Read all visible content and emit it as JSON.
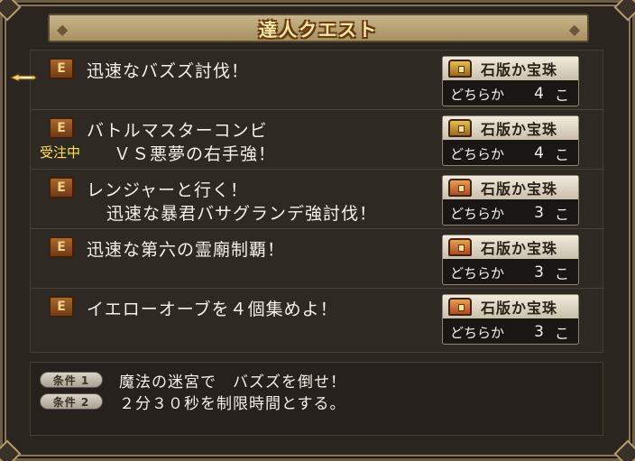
{
  "title": "達人クエスト",
  "quests": [
    {
      "title_line1": "迅速なバズズ討伐！",
      "title_line2": "",
      "status": "",
      "reward": {
        "item": "石版か宝珠",
        "choice": "どちらか",
        "count": "4",
        "unit": "こ",
        "chest": "gold"
      }
    },
    {
      "title_line1": "バトルマスターコンビ",
      "title_line2": "ＶＳ悪夢の右手強！",
      "status": "受注中",
      "reward": {
        "item": "石版か宝珠",
        "choice": "どちらか",
        "count": "4",
        "unit": "こ",
        "chest": "gold"
      }
    },
    {
      "title_line1": "レンジャーと行く！",
      "title_line2": "迅速な暴君バサグランデ強討伐！",
      "status": "",
      "reward": {
        "item": "石版か宝珠",
        "choice": "どちらか",
        "count": "3",
        "unit": "こ",
        "chest": "red"
      }
    },
    {
      "title_line1": "迅速な第六の霊廟制覇！",
      "title_line2": "",
      "status": "",
      "reward": {
        "item": "石版か宝珠",
        "choice": "どちらか",
        "count": "3",
        "unit": "こ",
        "chest": "red"
      }
    },
    {
      "title_line1": "イエローオーブを４個集めよ！",
      "title_line2": "",
      "status": "",
      "reward": {
        "item": "石版か宝珠",
        "choice": "どちらか",
        "count": "3",
        "unit": "こ",
        "chest": "red"
      }
    }
  ],
  "conditions": [
    {
      "label": "条件 1",
      "text": "魔法の迷宮で　バズズを倒せ！"
    },
    {
      "label": "条件 2",
      "text": "２分３０秒を制限時間とする。"
    }
  ],
  "icons": {
    "quest": "quest-book-icon",
    "cursor": "pointing-hand-cursor-icon"
  },
  "colors": {
    "accent_title": "#f8e7a6",
    "status": "#ffe54a"
  }
}
